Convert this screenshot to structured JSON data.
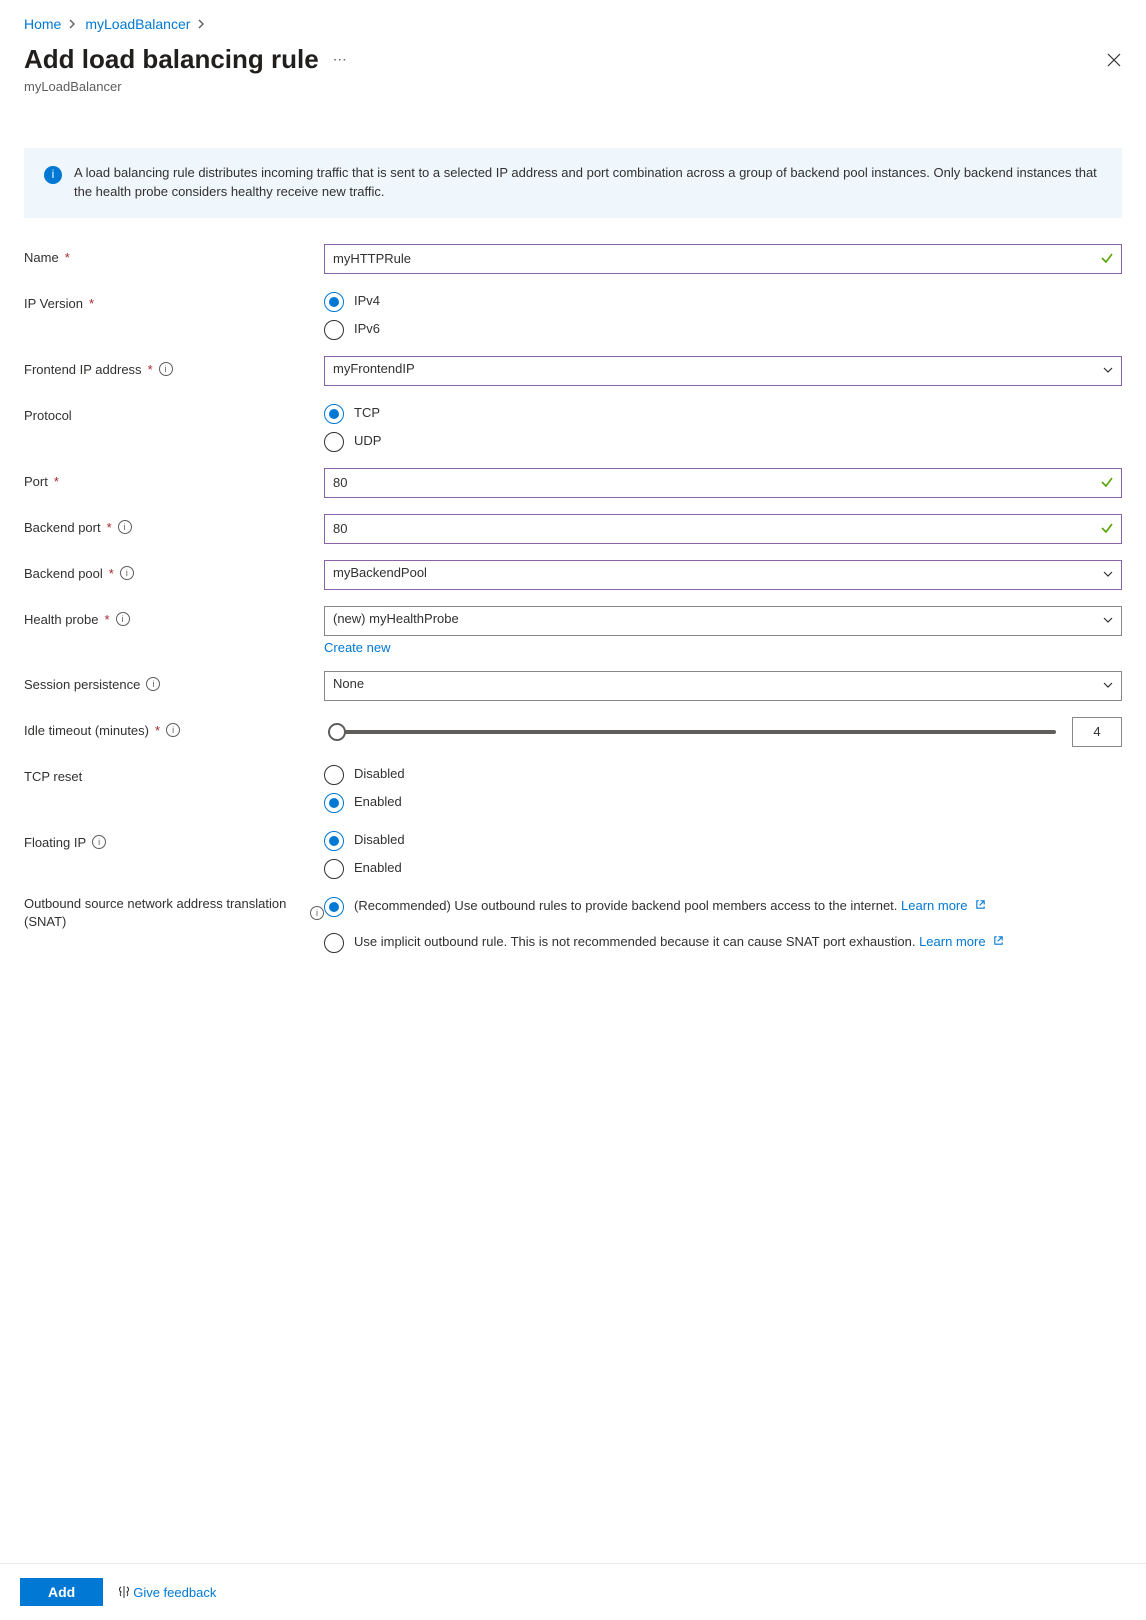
{
  "breadcrumb": {
    "home": "Home",
    "parent": "myLoadBalancer"
  },
  "header": {
    "title": "Add load balancing rule",
    "subtitle": "myLoadBalancer"
  },
  "info": {
    "text": "A load balancing rule distributes incoming traffic that is sent to a selected IP address and port combination across a group of backend pool instances. Only backend instances that the health probe considers healthy receive new traffic."
  },
  "fields": {
    "name": {
      "label": "Name",
      "value": "myHTTPRule"
    },
    "ipVersion": {
      "label": "IP Version",
      "opt1": "IPv4",
      "opt2": "IPv6"
    },
    "frontendIp": {
      "label": "Frontend IP address",
      "value": "myFrontendIP"
    },
    "protocol": {
      "label": "Protocol",
      "opt1": "TCP",
      "opt2": "UDP"
    },
    "port": {
      "label": "Port",
      "value": "80"
    },
    "backendPort": {
      "label": "Backend port",
      "value": "80"
    },
    "backendPool": {
      "label": "Backend pool",
      "value": "myBackendPool"
    },
    "healthProbe": {
      "label": "Health probe",
      "value": "(new) myHealthProbe",
      "createNew": "Create new"
    },
    "sessionPersistence": {
      "label": "Session persistence",
      "value": "None"
    },
    "idleTimeout": {
      "label": "Idle timeout (minutes)",
      "value": "4"
    },
    "tcpReset": {
      "label": "TCP reset",
      "opt1": "Disabled",
      "opt2": "Enabled"
    },
    "floatingIp": {
      "label": "Floating IP",
      "opt1": "Disabled",
      "opt2": "Enabled"
    },
    "snat": {
      "label": "Outbound source network address translation (SNAT)",
      "opt1_a": "(Recommended) Use outbound rules to provide backend pool members access to the internet. ",
      "opt1_link": "Learn more",
      "opt2_a": "Use implicit outbound rule. This is not recommended because it can cause SNAT port exhaustion. ",
      "opt2_link": "Learn more"
    }
  },
  "footer": {
    "add": "Add",
    "feedback": "Give feedback"
  }
}
